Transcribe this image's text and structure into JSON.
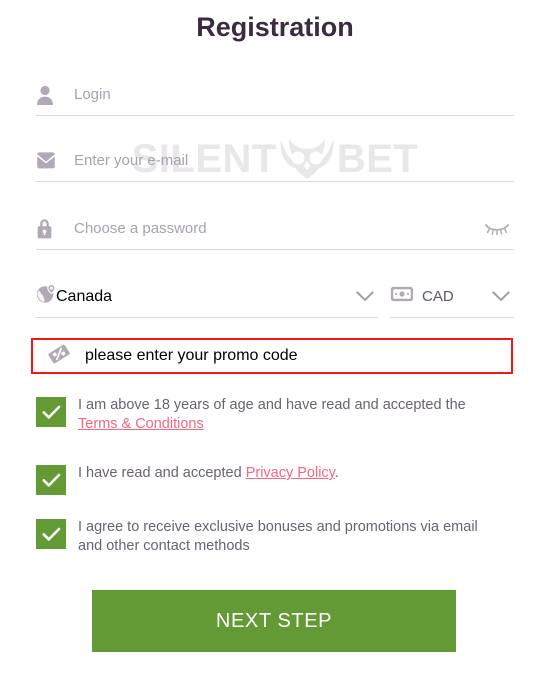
{
  "page": {
    "title": "Registration"
  },
  "watermark": {
    "left_text": "SILENT",
    "right_text": "BET",
    "logo_name": "owl-logo"
  },
  "fields": {
    "login": {
      "icon": "user-icon",
      "placeholder": "Login",
      "value": ""
    },
    "email": {
      "icon": "envelope-icon",
      "placeholder": "Enter your e-mail",
      "value": ""
    },
    "password": {
      "icon": "lock-icon",
      "placeholder": "Choose a password",
      "value": "",
      "toggle_icon": "eye-closed-icon"
    },
    "country": {
      "icon": "globe-pin-icon",
      "value": "Canada",
      "chevron": "chevron-down-icon"
    },
    "currency": {
      "icon": "banknote-icon",
      "value": "CAD",
      "chevron": "chevron-down-icon"
    },
    "promo": {
      "icon": "percent-tag-icon",
      "placeholder": "please enter your promo code",
      "value": "",
      "highlight_color": "#f41717",
      "highlighted": true
    }
  },
  "checkboxes": [
    {
      "name": "age-terms",
      "checked": true,
      "text_before": "I am above 18 years of age and have read and accepted the ",
      "link_text": "Terms & Conditions",
      "text_after": ""
    },
    {
      "name": "privacy-policy",
      "checked": true,
      "text_before": "I have read and accepted ",
      "link_text": "Privacy Policy",
      "text_after": "."
    },
    {
      "name": "marketing-consent",
      "checked": true,
      "text_before": "I agree to receive exclusive bonuses and promotions via email and other contact methods",
      "link_text": "",
      "text_after": ""
    }
  ],
  "actions": {
    "next_step_label": "NEXT STEP"
  },
  "colors": {
    "title": "#3c2b40",
    "placeholder": "#a9a1ad",
    "value_text": "#5f5663",
    "label_text": "#6b6270",
    "link": "#f5667f",
    "green": "#639a36",
    "underline": "#ded9e0",
    "promo_border": "#f41717",
    "watermark": "#e9e7ea"
  }
}
